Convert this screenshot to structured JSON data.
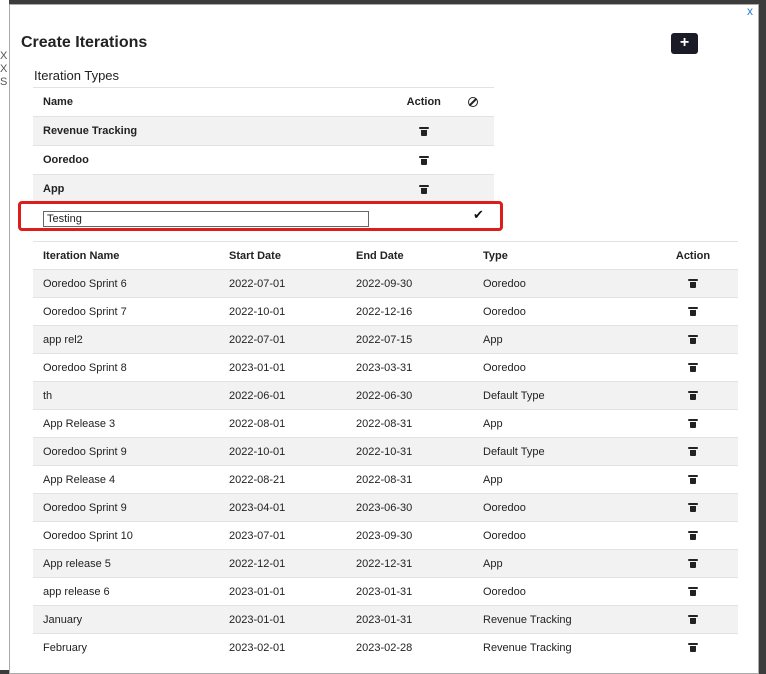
{
  "background_strip": [
    "X",
    "X",
    "S"
  ],
  "modal": {
    "close_label": "x",
    "title": "Create Iterations",
    "add_label": "+",
    "types_title": "Iteration Types"
  },
  "types_table": {
    "header": {
      "name": "Name",
      "action": "Action"
    },
    "rows": [
      {
        "name": "Revenue Tracking"
      },
      {
        "name": "Ooredoo"
      },
      {
        "name": "App"
      }
    ],
    "new_row": {
      "value": "Testing"
    }
  },
  "iterations_table": {
    "header": {
      "name": "Iteration Name",
      "start": "Start Date",
      "end": "End Date",
      "type": "Type",
      "action": "Action"
    },
    "rows": [
      {
        "name": "Ooredoo Sprint 6",
        "start": "2022-07-01",
        "end": "2022-09-30",
        "type": "Ooredoo"
      },
      {
        "name": "Ooredoo Sprint 7",
        "start": "2022-10-01",
        "end": "2022-12-16",
        "type": "Ooredoo"
      },
      {
        "name": "app rel2",
        "start": "2022-07-01",
        "end": "2022-07-15",
        "type": "App"
      },
      {
        "name": "Ooredoo Sprint 8",
        "start": "2023-01-01",
        "end": "2023-03-31",
        "type": "Ooredoo"
      },
      {
        "name": "th",
        "start": "2022-06-01",
        "end": "2022-06-30",
        "type": "Default Type"
      },
      {
        "name": "App Release 3",
        "start": "2022-08-01",
        "end": "2022-08-31",
        "type": "App"
      },
      {
        "name": "Ooredoo Sprint 9",
        "start": "2022-10-01",
        "end": "2022-10-31",
        "type": "Default Type"
      },
      {
        "name": "App Release 4",
        "start": "2022-08-21",
        "end": "2022-08-31",
        "type": "App"
      },
      {
        "name": "Ooredoo Sprint 9",
        "start": "2023-04-01",
        "end": "2023-06-30",
        "type": "Ooredoo"
      },
      {
        "name": "Ooredoo Sprint 10",
        "start": "2023-07-01",
        "end": "2023-09-30",
        "type": "Ooredoo"
      },
      {
        "name": "App release 5",
        "start": "2022-12-01",
        "end": "2022-12-31",
        "type": "App"
      },
      {
        "name": "app release 6",
        "start": "2023-01-01",
        "end": "2023-01-31",
        "type": "Ooredoo"
      },
      {
        "name": "January",
        "start": "2023-01-01",
        "end": "2023-01-31",
        "type": "Revenue Tracking"
      },
      {
        "name": "February",
        "start": "2023-02-01",
        "end": "2023-02-28",
        "type": "Revenue Tracking"
      }
    ]
  },
  "colors": {
    "accent": "#2a7ad8",
    "highlight": "#dd1c1c",
    "add_button": "#1a1b26"
  }
}
